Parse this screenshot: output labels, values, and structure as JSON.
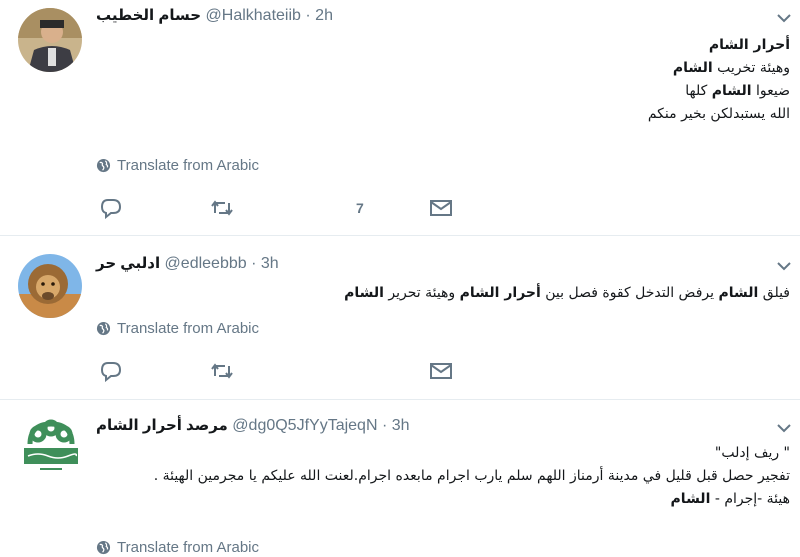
{
  "tweets": [
    {
      "display_name": "حسام الخطيب",
      "handle": "@Halkhateiib",
      "separator": "·",
      "time": "2h",
      "lines": [
        [
          {
            "t": "أحرار الشام",
            "b": true
          }
        ],
        [
          {
            "t": "وهيئة تخريب ",
            "b": false
          },
          {
            "t": "الشام",
            "b": true
          }
        ],
        [
          {
            "t": "ضيعوا ",
            "b": false
          },
          {
            "t": "الشام",
            "b": true
          },
          {
            "t": " كلها",
            "b": false
          }
        ],
        [
          {
            "t": "الله يستبدلكن بخير منكم",
            "b": false
          }
        ]
      ],
      "translate": "Translate from Arabic",
      "like_count": "7"
    },
    {
      "display_name": "ادلبي حر",
      "handle": "@edleebbb",
      "separator": "·",
      "time": "3h",
      "lines": [
        [
          {
            "t": "فيلق ",
            "b": false
          },
          {
            "t": "الشام",
            "b": true
          },
          {
            "t": " يرفض التدخل كقوة فصل بين ",
            "b": false
          },
          {
            "t": "أحرار الشام",
            "b": true
          },
          {
            "t": " وهيئة تحرير ",
            "b": false
          },
          {
            "t": "الشام",
            "b": true
          }
        ]
      ],
      "translate": "Translate from Arabic",
      "like_count": ""
    },
    {
      "display_name": "مرصد أحرار الشام",
      "handle": "@dg0Q5JfYyTajeqN",
      "separator": "·",
      "time": "3h",
      "lines": [
        [
          {
            "t": "\" ريف إدلب\"",
            "b": false
          }
        ],
        [
          {
            "t": "تفجير حصل قبل قليل في مدينة أرمناز اللهم سلم يارب  اجرام مابعده اجرام.لعنت الله عليكم يا مجرمين الهيئة .",
            "b": false
          }
        ],
        [
          {
            "t": "هيئة -إجرام - ",
            "b": false
          },
          {
            "t": "الشام",
            "b": true
          }
        ]
      ],
      "translate": "Translate from Arabic",
      "like_count": ""
    }
  ],
  "icons": {
    "reply": "reply-icon",
    "retweet": "retweet-icon",
    "like": "like-icon",
    "dm": "message-icon",
    "globe": "globe-icon",
    "chevron": "chevron-down-icon"
  },
  "colors": {
    "text": "#14171a",
    "secondary": "#657786",
    "divider": "#e6ecf0"
  }
}
